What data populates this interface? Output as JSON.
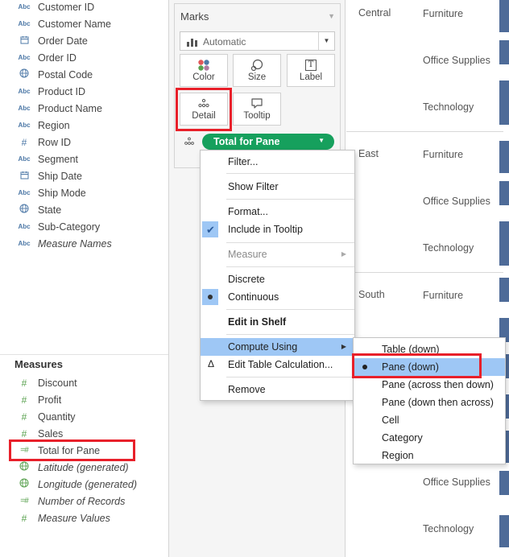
{
  "data_pane": {
    "dimensions": [
      {
        "label": "Customer ID",
        "type": "Abc"
      },
      {
        "label": "Customer Name",
        "type": "Abc"
      },
      {
        "label": "Order Date",
        "type": "date"
      },
      {
        "label": "Order ID",
        "type": "Abc"
      },
      {
        "label": "Postal Code",
        "type": "geo"
      },
      {
        "label": "Product ID",
        "type": "Abc"
      },
      {
        "label": "Product Name",
        "type": "Abc"
      },
      {
        "label": "Region",
        "type": "Abc"
      },
      {
        "label": "Row ID",
        "type": "number"
      },
      {
        "label": "Segment",
        "type": "Abc"
      },
      {
        "label": "Ship Date",
        "type": "date"
      },
      {
        "label": "Ship Mode",
        "type": "Abc"
      },
      {
        "label": "State",
        "type": "geo"
      },
      {
        "label": "Sub-Category",
        "type": "Abc"
      },
      {
        "label": "Measure Names",
        "type": "Abc",
        "italic": true
      }
    ],
    "abc_glyph": "Abc",
    "measures_title": "Measures",
    "measures": [
      {
        "label": "Discount",
        "type": "number"
      },
      {
        "label": "Profit",
        "type": "number"
      },
      {
        "label": "Quantity",
        "type": "number"
      },
      {
        "label": "Sales",
        "type": "number"
      },
      {
        "label": "Total for Pane",
        "type": "calc"
      },
      {
        "label": "Latitude (generated)",
        "type": "geo",
        "italic": true
      },
      {
        "label": "Longitude (generated)",
        "type": "geo",
        "italic": true
      },
      {
        "label": "Number of Records",
        "type": "calc",
        "italic": true
      },
      {
        "label": "Measure Values",
        "type": "number",
        "italic": true
      }
    ]
  },
  "marks": {
    "title": "Marks",
    "mark_type": "Automatic",
    "buttons": {
      "color": "Color",
      "size": "Size",
      "label": "Label",
      "detail": "Detail",
      "tooltip": "Tooltip"
    },
    "label_glyph": "T",
    "pill": "Total for Pane"
  },
  "view": {
    "regions": [
      "Central",
      "East",
      "South"
    ],
    "categories": [
      "Furniture",
      "Office Supplies",
      "Technology"
    ],
    "bar_color": "#4e6b98"
  },
  "context_menu": {
    "items": {
      "filter": "Filter...",
      "show_filter": "Show Filter",
      "format": "Format...",
      "include_tooltip": "Include in Tooltip",
      "measure": "Measure",
      "discrete": "Discrete",
      "continuous": "Continuous",
      "edit_in_shelf": "Edit in Shelf",
      "compute_using": "Compute Using",
      "edit_table_calc": "Edit Table Calculation...",
      "remove": "Remove"
    },
    "highlight_color": "#9ec7f5"
  },
  "compute_using_menu": {
    "items": [
      "Table (down)",
      "Pane (down)",
      "Pane (across then down)",
      "Pane (down then across)",
      "Cell",
      "Category",
      "Region"
    ],
    "selected": "Pane (down)"
  },
  "colors": {
    "pill_green": "#16a05d",
    "annotation_red": "#e8202a",
    "dimension_blue": "#4e79a7",
    "measure_green": "#59a14f"
  }
}
